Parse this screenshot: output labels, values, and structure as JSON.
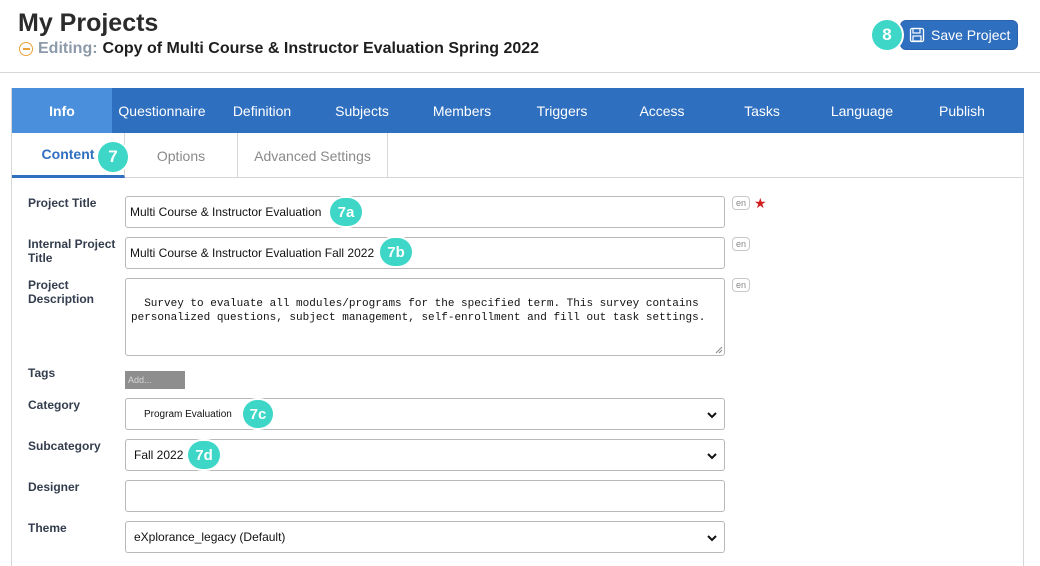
{
  "header": {
    "title": "My Projects",
    "editing_label": "Editing:",
    "project_name": "Copy of Multi Course & Instructor Evaluation Spring 2022",
    "save_label": "Save Project",
    "callout_save": "8"
  },
  "nav": {
    "items": [
      "Info",
      "Questionnaire",
      "Definition",
      "Subjects",
      "Members",
      "Triggers",
      "Access",
      "Tasks",
      "Language",
      "Publish"
    ],
    "active": "Info"
  },
  "subtabs": {
    "items": [
      "Content",
      "Options",
      "Advanced Settings"
    ],
    "active": "Content",
    "callout": "7"
  },
  "form": {
    "project_title": {
      "label": "Project Title",
      "value": "Multi Course & Instructor Evaluation",
      "lang": "en",
      "callout": "7a"
    },
    "internal_title": {
      "label_line1": "Internal Project",
      "label_line2": "Title",
      "value": "Multi Course & Instructor Evaluation Fall 2022",
      "lang": "en",
      "callout": "7b"
    },
    "description": {
      "label_line1": "Project",
      "label_line2": "Description",
      "value": "Survey to evaluate all modules/programs for the specified term. This survey contains\npersonalized questions, subject management, self-enrollment and fill out task settings.",
      "lang": "en"
    },
    "tags": {
      "label": "Tags",
      "placeholder": "Add..."
    },
    "category": {
      "label": "Category",
      "value": "Program Evaluation",
      "callout": "7c"
    },
    "subcategory": {
      "label": "Subcategory",
      "value": "Fall 2022",
      "callout": "7d"
    },
    "designer": {
      "label": "Designer",
      "value": ""
    },
    "theme": {
      "label": "Theme",
      "value": "eXplorance_legacy (Default)"
    }
  },
  "colors": {
    "primary": "#2f6fbf",
    "nav_active": "#4a8fdc",
    "callout": "#3ed6c7",
    "required": "#d21f1f",
    "editing_icon": "#e8a23a"
  }
}
